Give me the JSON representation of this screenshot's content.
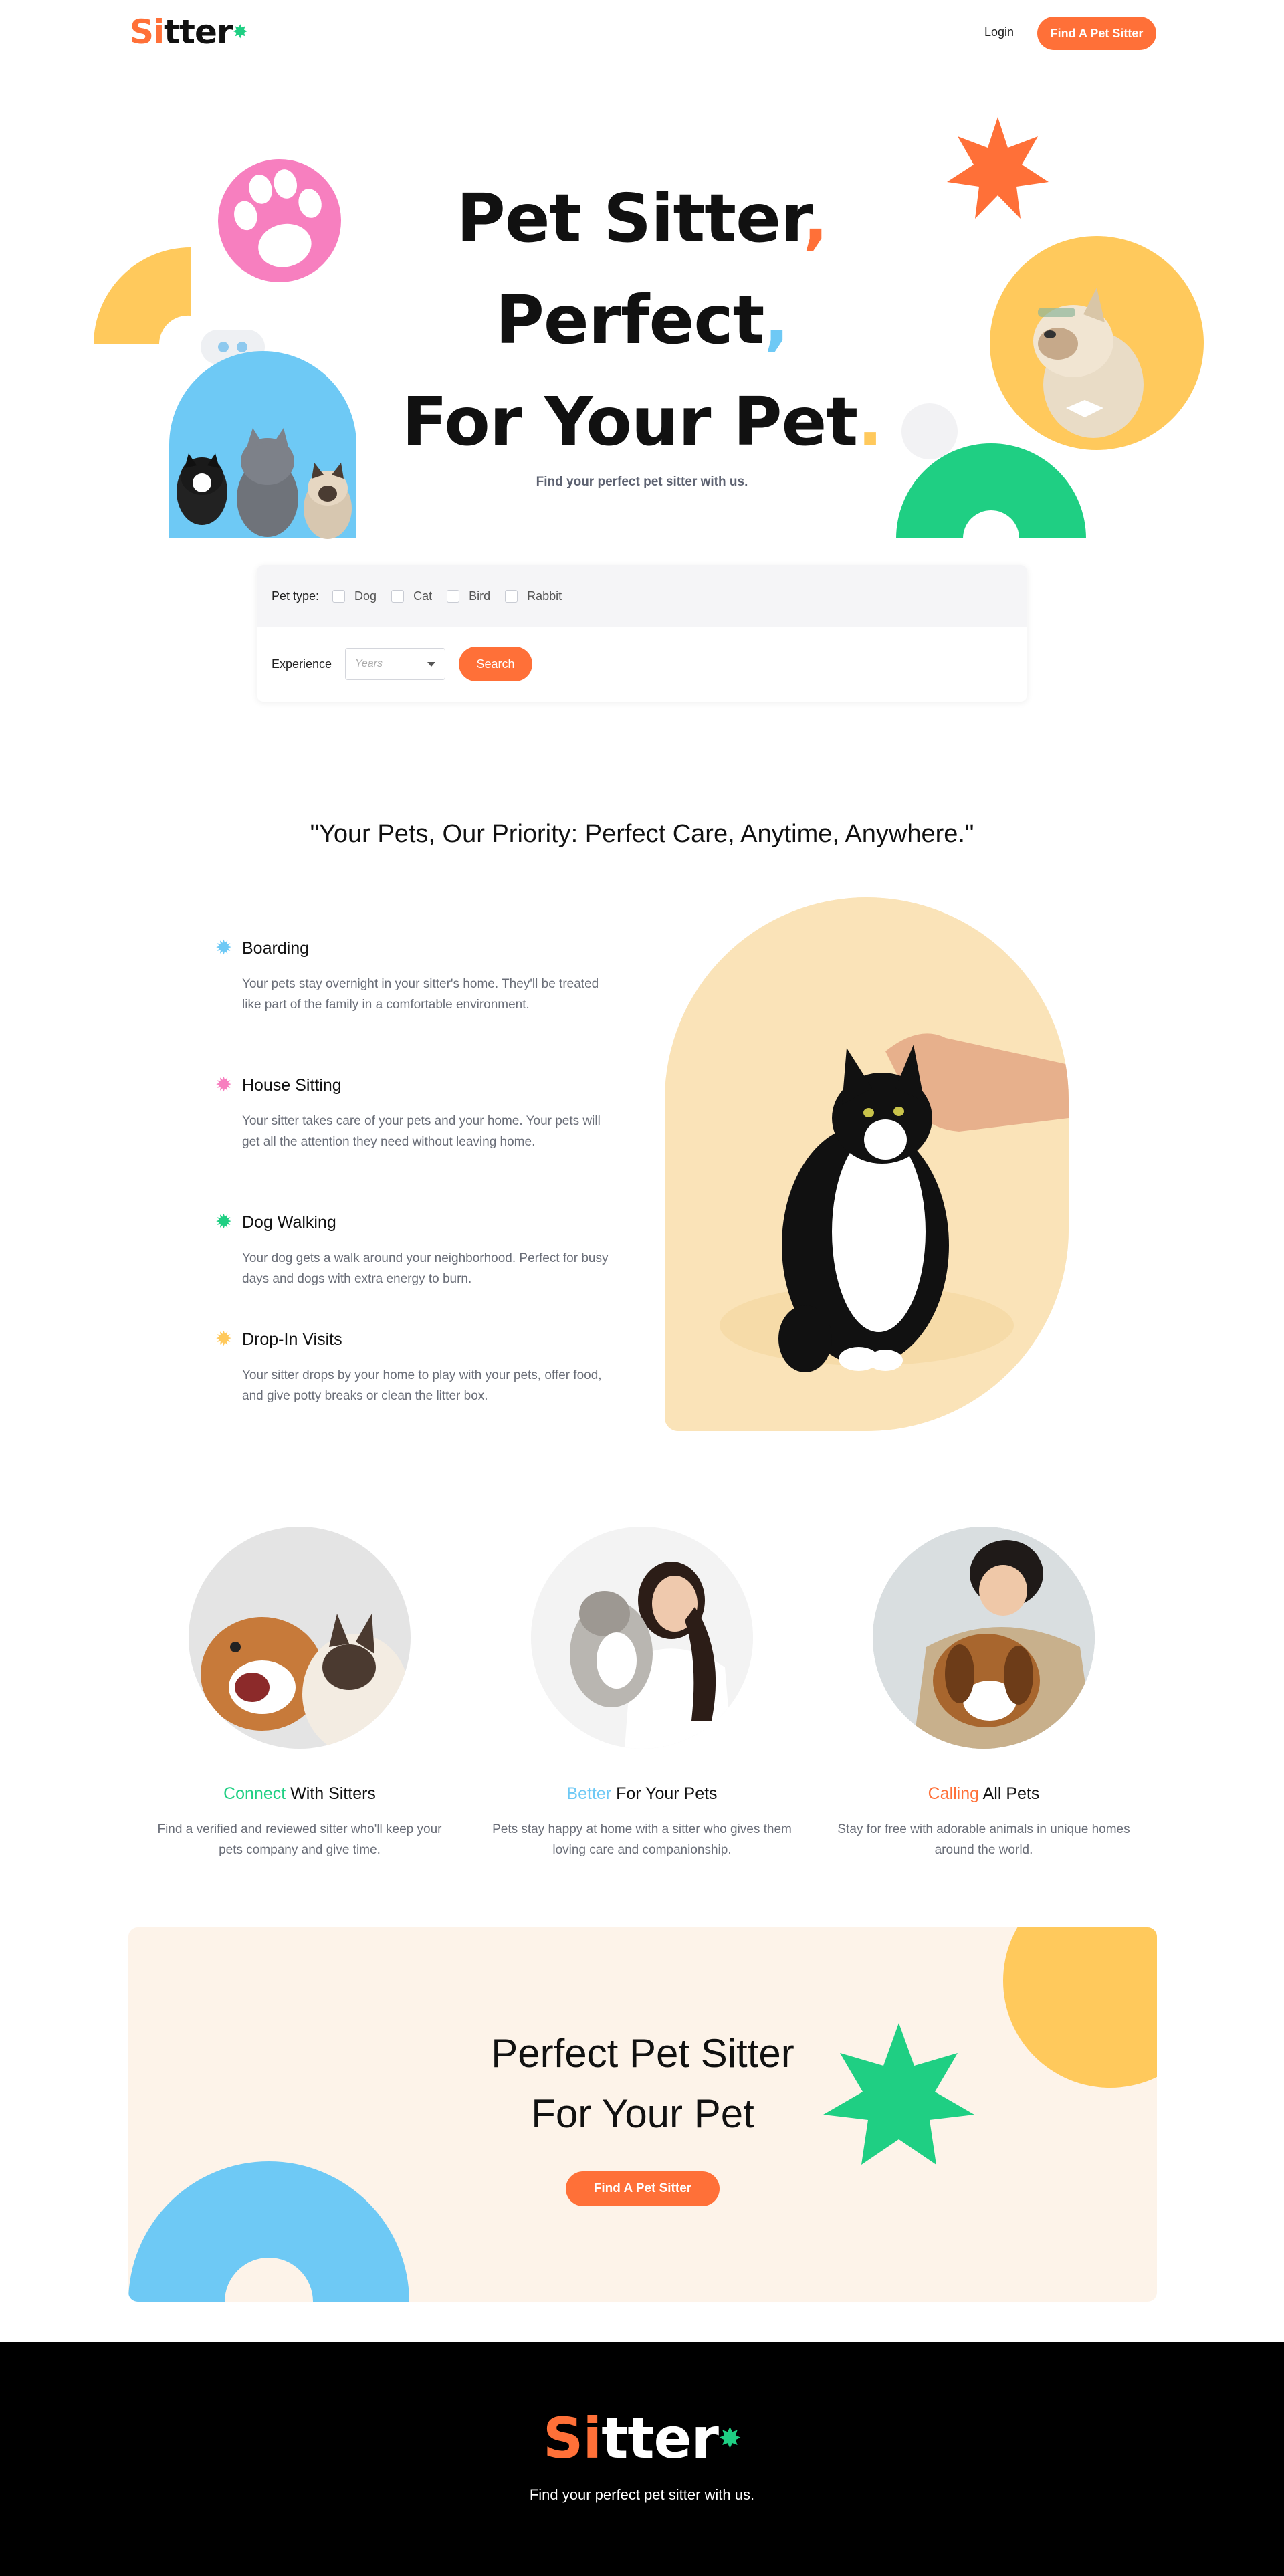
{
  "header": {
    "logo_prefix": "Si",
    "logo_suffix": "tter",
    "login_label": "Login",
    "cta_label": "Find A Pet Sitter"
  },
  "hero": {
    "line1": "Pet Sitter",
    "line2": "Perfect",
    "line3": "For Your Pet",
    "subtitle": "Find your perfect pet sitter with us."
  },
  "search": {
    "pet_type_label": "Pet type:",
    "pet_types": [
      "Dog",
      "Cat",
      "Bird",
      "Rabbit"
    ],
    "experience_label": "Experience",
    "experience_placeholder": "Years",
    "search_label": "Search"
  },
  "services": {
    "tagline": "\"Your Pets, Our Priority: Perfect Care, Anytime, Anywhere.\"",
    "items": [
      {
        "title": "Boarding",
        "desc": "Your pets stay overnight in your sitter's home. They'll be treated like part of the family in a comfortable environment.",
        "color": "#6ec9f5"
      },
      {
        "title": "House Sitting",
        "desc": "Your sitter takes care of your pets and your home. Your pets will get all the attention they need without leaving home.",
        "color": "#f77fbf"
      },
      {
        "title": "Dog Walking",
        "desc": "Your dog gets a walk around your neighborhood. Perfect for busy days and dogs with extra energy to burn.",
        "color": "#1fcf83"
      },
      {
        "title": "Drop-In Visits",
        "desc": "Your sitter drops by your home to play with your pets, offer food, and give potty breaks or clean the litter box.",
        "color": "#ffc95c"
      }
    ]
  },
  "features": [
    {
      "accent": "Connect",
      "rest": " With Sitters",
      "accent_color": "#1fcf83",
      "desc": "Find a verified and reviewed sitter who'll keep your pets company and give time."
    },
    {
      "accent": "Better",
      "rest": " For Your Pets",
      "accent_color": "#6ec9f5",
      "desc": "Pets stay happy at home with a sitter who gives them loving care and companionship."
    },
    {
      "accent": "Calling",
      "rest": " All Pets",
      "accent_color": "#ff7038",
      "desc": "Stay for free with adorable animals in unique homes around the world."
    }
  ],
  "cta": {
    "line1": "Perfect Pet Sitter",
    "line2": "For Your Pet",
    "button_label": "Find A Pet Sitter"
  },
  "footer": {
    "logo_prefix": "Si",
    "logo_suffix": "tter",
    "tagline": "Find your perfect pet sitter with us."
  },
  "colors": {
    "orange": "#ff7038",
    "green": "#1fcf83",
    "blue": "#6ec9f5",
    "yellow": "#ffc95c",
    "pink": "#f77fbf"
  }
}
